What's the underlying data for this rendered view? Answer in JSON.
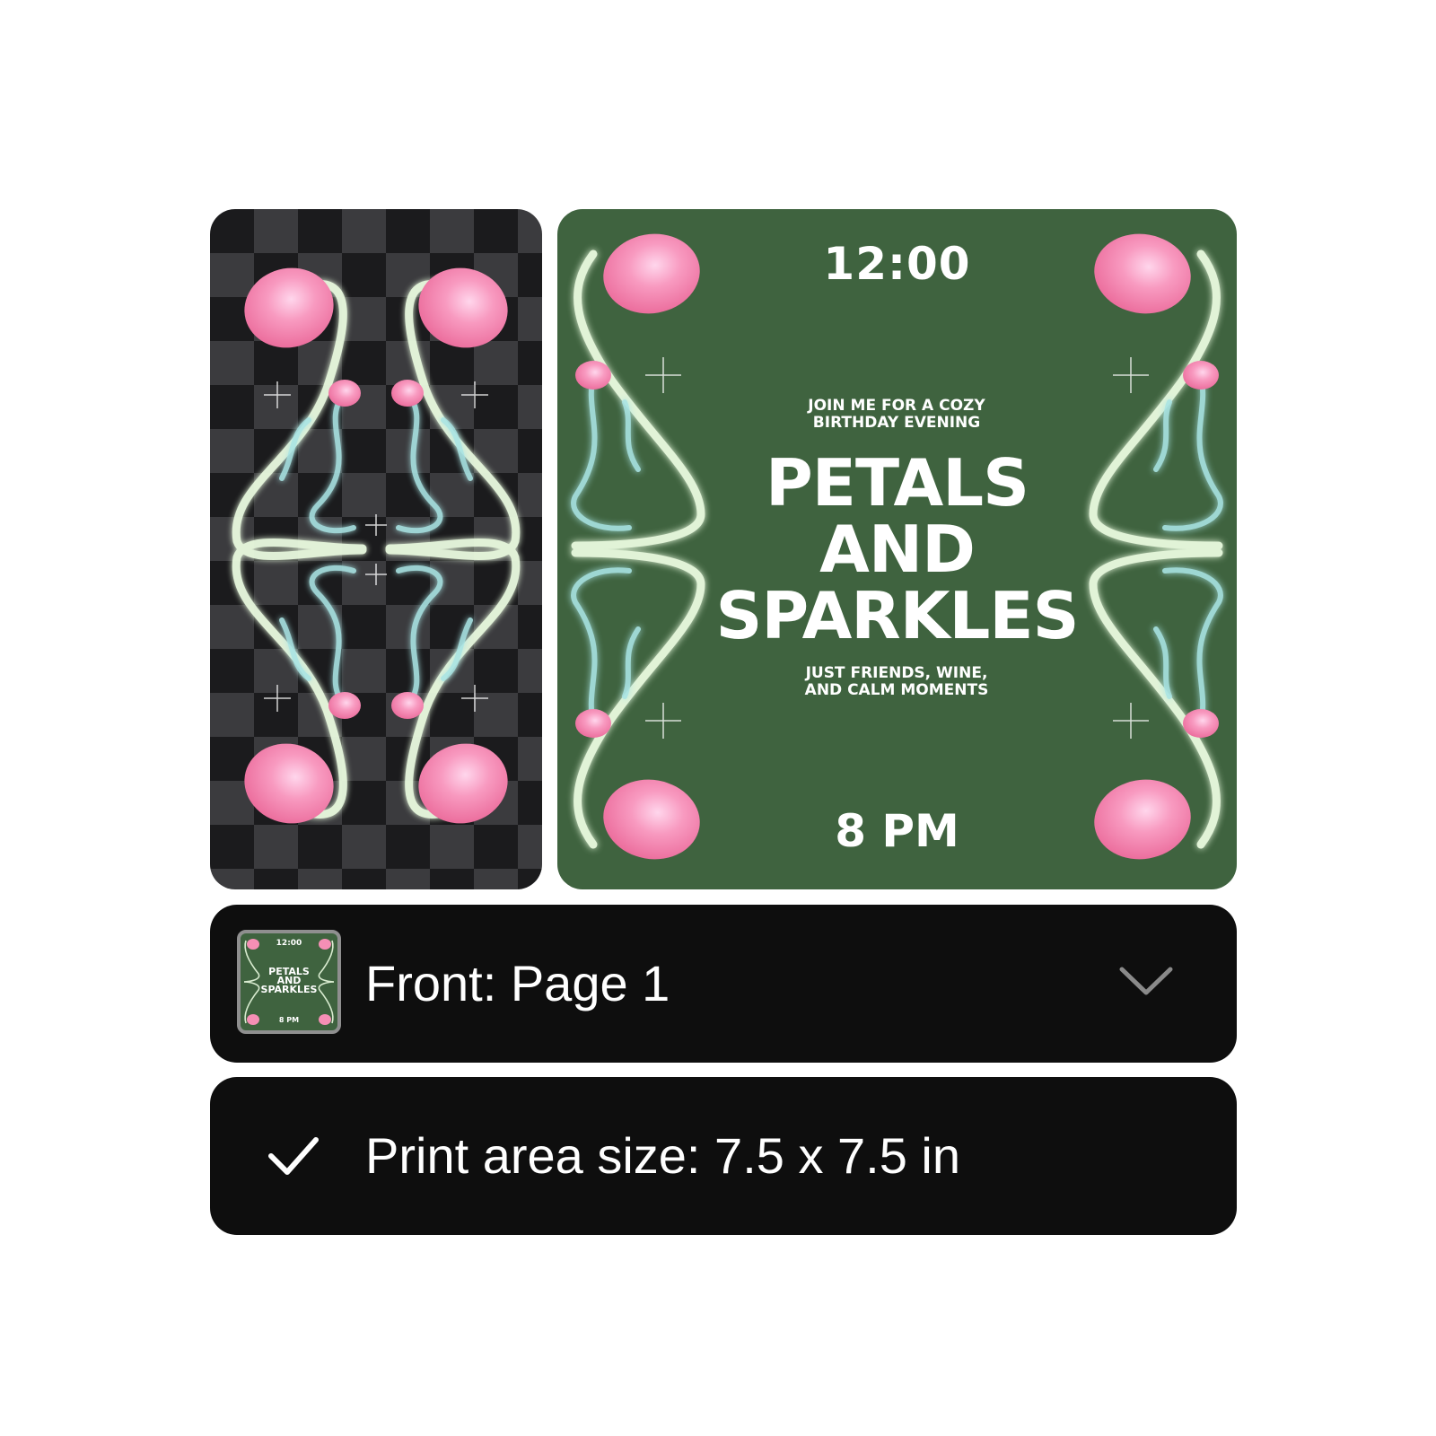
{
  "previews": {
    "back": {
      "background": "checkerboard",
      "colors": {
        "dark": "#1b1b1d",
        "light": "#3b3b3e"
      }
    },
    "front": {
      "background": "#3f633f",
      "time_top": "12:00",
      "intro_line1": "JOIN ME FOR A COZY",
      "intro_line2": "BIRTHDAY EVENING",
      "title_line1": "PETALS",
      "title_line2": "AND",
      "title_line3": "SPARKLES",
      "sub_line1": "JUST FRIENDS, WINE,",
      "sub_line2": "AND CALM MOMENTS",
      "time_bottom": "8 PM"
    }
  },
  "page_selector": {
    "label": "Front: Page 1",
    "thumbnail": {
      "time": "12:00",
      "title_line1": "PETALS",
      "title_line2": "AND",
      "title_line3": "SPARKLES",
      "time_bottom": "8 PM"
    },
    "icon": "chevron-down-icon"
  },
  "print_area": {
    "label": "Print area size: 7.5 x 7.5 in",
    "icon": "checkmark-icon"
  },
  "colors": {
    "flower_pink": "#f58fb5",
    "flower_highlight": "#ffd0ea",
    "stem_glow": "#e9fbe3",
    "stem_teal": "#9ee0df",
    "bar_background": "#0e0e0e",
    "text": "#ffffff"
  }
}
